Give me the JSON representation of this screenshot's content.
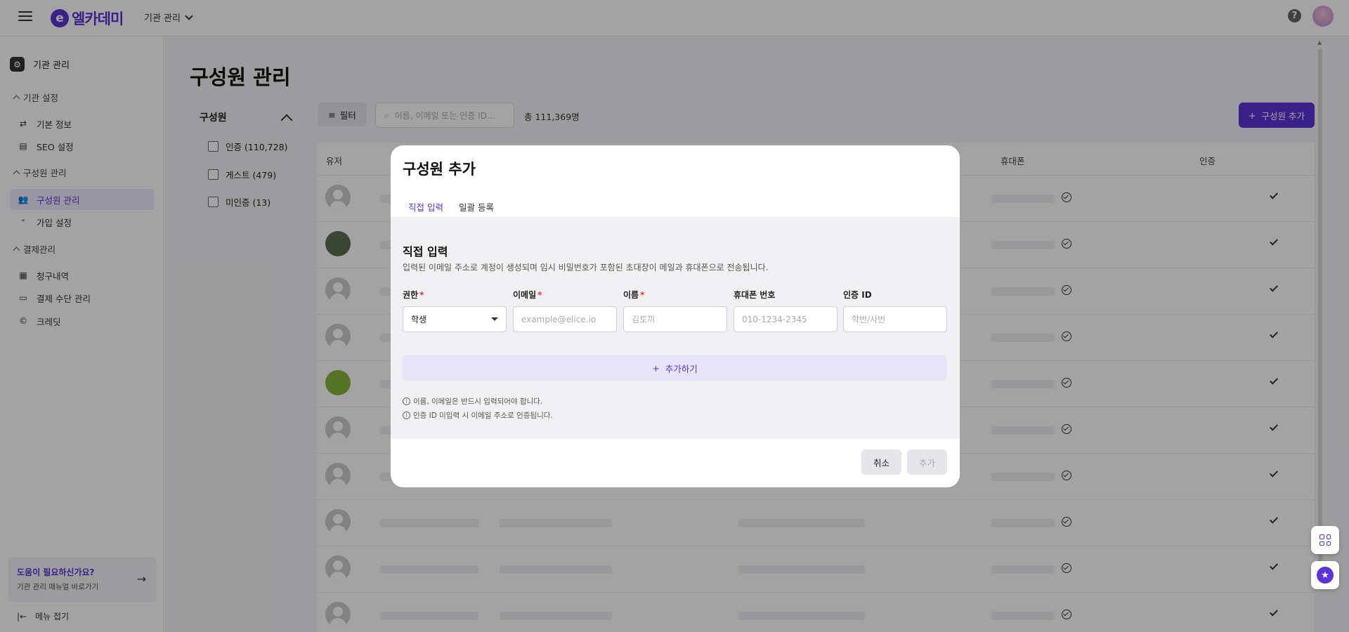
{
  "topbar": {
    "logo_mark": "e",
    "logo_text": "엘카데미",
    "org_select": "기관 관리",
    "help_glyph": "?"
  },
  "sidebar": {
    "header": "기관 관리",
    "sections": [
      {
        "label": "기관 설정"
      },
      {
        "label": "구성원 관리"
      },
      {
        "label": "결제관리"
      }
    ],
    "items": [
      {
        "label": "기본 정보",
        "icon": "sliders-icon"
      },
      {
        "label": "SEO 설정",
        "icon": "seo-icon"
      },
      {
        "label": "구성원 관리",
        "icon": "users-icon",
        "active": true
      },
      {
        "label": "가입 설정",
        "icon": "user-plus-icon"
      },
      {
        "label": "청구내역",
        "icon": "receipt-icon"
      },
      {
        "label": "결제 수단 관리",
        "icon": "card-icon"
      },
      {
        "label": "크레딧",
        "icon": "credit-icon"
      }
    ],
    "help": {
      "title": "도움이 필요하신가요?",
      "subtitle": "기관 관리 매뉴얼 바로가기"
    },
    "collapse": "메뉴 접기"
  },
  "main": {
    "title": "구성원 관리",
    "filter_panel": {
      "title": "구성원",
      "options": [
        "인증 (110,728)",
        "게스트 (479)",
        "미인증 (13)"
      ]
    },
    "filter_button": "필터",
    "search_placeholder": "이름, 이메일 또는 인증 ID...",
    "total": "총 111,369명",
    "add_button": "구성원 추가",
    "table": {
      "headers": {
        "user": "유저",
        "phone": "휴대폰",
        "verified": "인증"
      },
      "row_count": 10
    }
  },
  "modal": {
    "title": "구성원 추가",
    "tabs": [
      "직접 입력",
      "일괄 등록"
    ],
    "body_title": "직접 입력",
    "body_desc": "입력된 이메일 주소로 계정이 생성되며 임시 비밀번호가 포함된 초대장이 메일과 휴대폰으로 전송됩니다.",
    "fields": {
      "role": {
        "label": "권한",
        "value": "학생"
      },
      "email": {
        "label": "이메일",
        "placeholder": "example@elice.io"
      },
      "name": {
        "label": "이름",
        "placeholder": "김토끼"
      },
      "phone": {
        "label": "휴대폰 번호",
        "placeholder": "010-1234-2345"
      },
      "auth_id": {
        "label": "인증 ID",
        "placeholder": "학번/사번"
      }
    },
    "required_mark": "*",
    "add_row": "추가하기",
    "notes": [
      "이름, 이메일은 반드시 입력되어야 합니다.",
      "인증 ID 미입력 시 이메일 주소로 인증됩니다."
    ],
    "cancel": "취소",
    "submit": "추가"
  },
  "colors": {
    "accent": "#5b33d6",
    "required": "#e53935"
  }
}
